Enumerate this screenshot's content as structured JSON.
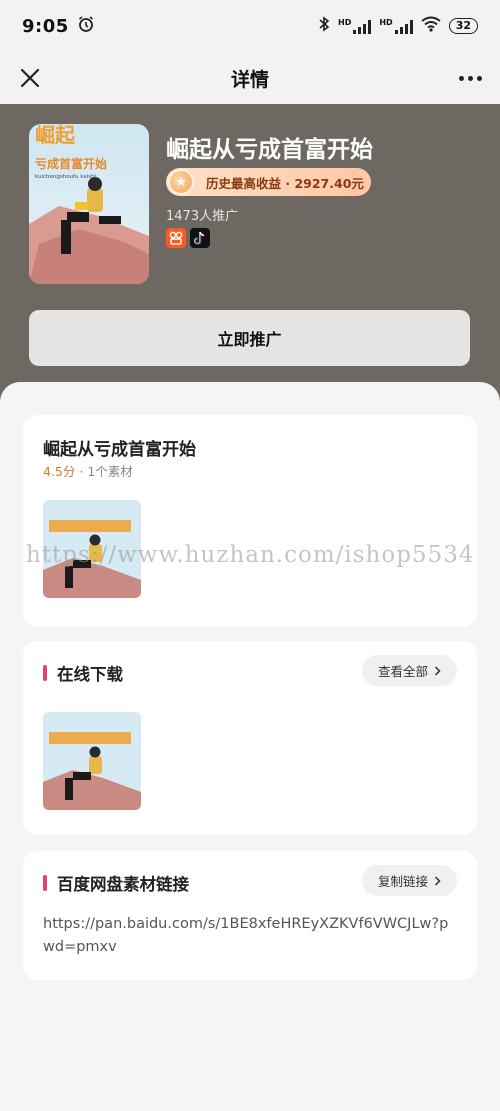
{
  "status_bar": {
    "time": "9:05",
    "network_1": "HD",
    "network_2": "HD",
    "battery": "32"
  },
  "nav": {
    "title": "详情"
  },
  "hero": {
    "name": "崛起从亏成首富开始",
    "earnings_label": "历史最高收益 · 2927.40元",
    "promo_count": "1473人推广",
    "promote_button": "立即推广",
    "platforms": [
      "kuaishou-icon",
      "douyin-icon"
    ],
    "cover_text_top": "崛起",
    "cover_text_main": "亏成首富开始",
    "cover_text_pinyin": "kuichengshoufu kaishi"
  },
  "detail_card": {
    "title": "崛起从亏成首富开始",
    "score": "4.5分",
    "material_count": "1个素材"
  },
  "download_card": {
    "title": "在线下载",
    "view_all": "查看全部"
  },
  "baidu_card": {
    "title": "百度网盘素材链接",
    "copy_button": "复制链接",
    "link": "https://pan.baidu.com/s/1BE8xfeHREyXZKVf6VWCJLw?pwd=pmxv"
  },
  "watermark": "https://www.huzhan.com/ishop5534",
  "colors": {
    "accent": "#e8406a",
    "hero_bg": "#6e6862",
    "score": "#d47a2a"
  }
}
